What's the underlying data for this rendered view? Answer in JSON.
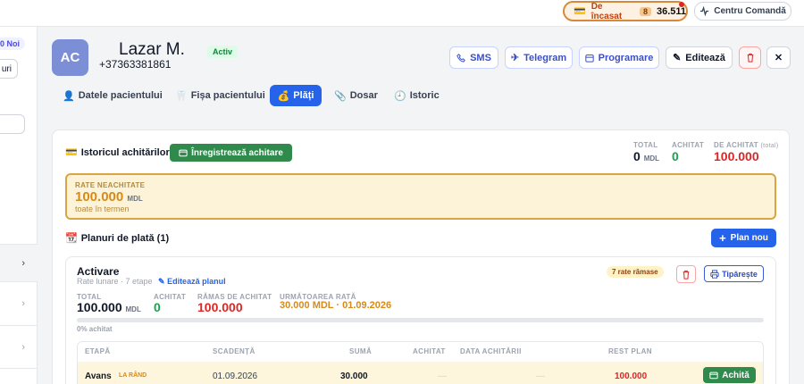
{
  "topbar": {
    "due_label": "De încasat",
    "due_count": "8",
    "due_amount": "36.511",
    "command_label": "Centru Comandă"
  },
  "sidebar": {
    "new_count": "0",
    "new_label": "Noi",
    "filter_label": "uri",
    "chevron": "›"
  },
  "patient": {
    "initials": "AC",
    "name": "Lazar M.",
    "phone": "+37363381861",
    "status": "Activ"
  },
  "actions": {
    "sms": "SMS",
    "telegram": "Telegram",
    "appointment": "Programare",
    "edit": "Editează"
  },
  "tabs": [
    {
      "label": "Datele pacientului",
      "icon": "👤"
    },
    {
      "label": "Fișa pacientului",
      "icon": "🦷"
    },
    {
      "label": "Plăți",
      "icon": "💰"
    },
    {
      "label": "Dosar",
      "icon": "📎"
    },
    {
      "label": "Istoric",
      "icon": "🕘"
    }
  ],
  "payments": {
    "history_title": "Istoricul achitărilor",
    "history_icon": "💳",
    "record_button": "Înregistrează achitare",
    "total_label": "TOTAL",
    "total_value": "0",
    "total_unit": "MDL",
    "paid_label": "ACHITAT",
    "paid_value": "0",
    "to_pay_label": "DE ACHITAT",
    "to_pay_note": "(total)",
    "to_pay_value": "100.000",
    "unpaid_label": "RATE NEACHITATE",
    "unpaid_value": "100.000",
    "unpaid_unit": "MDL",
    "unpaid_note": "toate în termen"
  },
  "plans": {
    "title": "Planuri de plată (1)",
    "icon": "📆",
    "new_button": "Plan nou",
    "plan": {
      "name": "Activare",
      "subtitle": "Rate lunare · 7 etape",
      "edit_link": "Editează planul",
      "remaining_badge": "7 rate rămase",
      "print_button": "Tipărește",
      "total_label": "TOTAL",
      "total_value": "100.000",
      "total_unit": "MDL",
      "paid_label": "ACHITAT",
      "paid_value": "0",
      "remaining_label": "RĂMAS DE ACHITAT",
      "remaining_value": "100.000",
      "next_label": "URMĂTOAREA RATĂ",
      "next_value": "30.000 MDL · 01.09.2026",
      "progress_percent": 0,
      "progress_label": "0% achitat",
      "columns": [
        "ETAPĂ",
        "SCADENȚĂ",
        "SUMĂ",
        "ACHITAT",
        "DATA ACHITĂRII",
        "REST PLAN"
      ],
      "rows": [
        {
          "stage": "Avans",
          "tag": "LA RÂND",
          "due": "01.09.2026",
          "amount": "30.000",
          "paid": "—",
          "paid_date": "—",
          "rest": "100.000",
          "action": "Achită"
        }
      ]
    }
  },
  "colors": {
    "primary": "#2563eb",
    "success": "#2f8a4c",
    "danger": "#dc2626",
    "warning": "#d68a1a"
  }
}
